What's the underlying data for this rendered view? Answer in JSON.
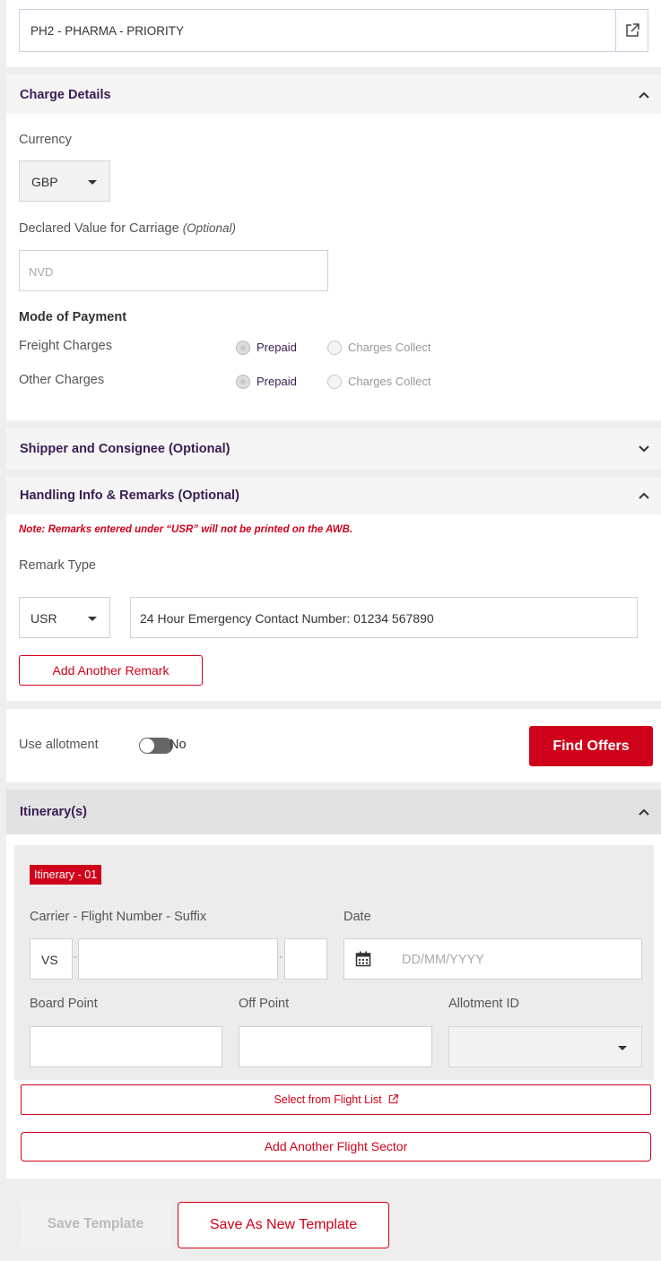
{
  "product": {
    "value": "PH2 - PHARMA - PRIORITY",
    "icon": "external-link-icon"
  },
  "charge_details": {
    "title": "Charge Details",
    "currency_label": "Currency",
    "currency_value": "GBP",
    "declared_label": "Declared Value for Carriage",
    "declared_optional": "(Optional)",
    "declared_placeholder": "NVD",
    "mode_title": "Mode of Payment",
    "freight_label": "Freight Charges",
    "other_label": "Other Charges",
    "prepaid": "Prepaid",
    "collect": "Charges Collect"
  },
  "shipper": {
    "title": "Shipper and Consignee (Optional)"
  },
  "handling": {
    "title": "Handling Info & Remarks (Optional)",
    "note": "Note: Remarks entered under “USR” will not be printed on the AWB.",
    "remark_type_label": "Remark Type",
    "remark_type_value": "USR",
    "remark_text": "24 Hour Emergency Contact Number: 01234 567890",
    "add_remark": "Add Another Remark"
  },
  "allotment": {
    "label": "Use allotment",
    "toggle": "No",
    "find_offers": "Find Offers"
  },
  "itinerary": {
    "title": "Itinerary(s)",
    "badge": "Itinerary - 01",
    "carrier_label": "Carrier - Flight Number - Suffix",
    "carrier_value": "VS",
    "date_label": "Date",
    "date_placeholder": "DD/MM/YYYY",
    "board_label": "Board Point",
    "off_label": "Off Point",
    "allot_label": "Allotment ID",
    "select_flight": "Select from Flight List",
    "add_sector": "Add Another Flight Sector"
  },
  "footer": {
    "save": "Save Template",
    "save_new": "Save As New Template"
  },
  "colors": {
    "accent": "#d0021b",
    "heading": "#3a1d52",
    "background": "#eeeeee"
  }
}
